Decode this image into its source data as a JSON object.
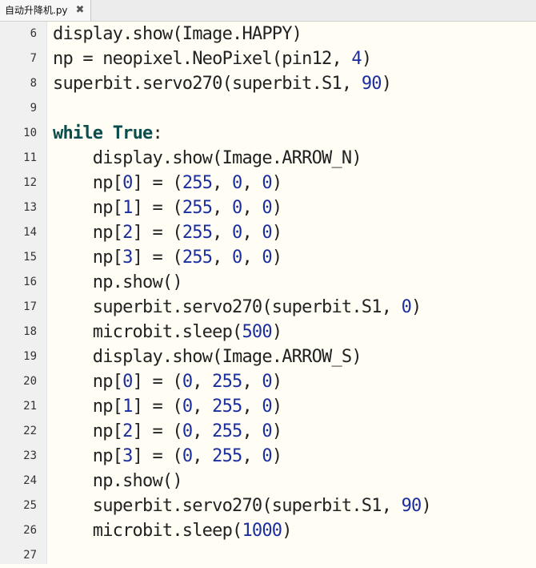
{
  "tab": {
    "title": "自动升降机.py",
    "close_icon": "✖"
  },
  "lines": [
    {
      "n": "6",
      "indent": "",
      "parts": [
        [
          "t",
          "display.show(Image.HAPPY)"
        ]
      ]
    },
    {
      "n": "7",
      "indent": "",
      "parts": [
        [
          "t",
          "np = neopixel.NeoPixel(pin12, "
        ],
        [
          "n",
          "4"
        ],
        [
          "t",
          ")"
        ]
      ]
    },
    {
      "n": "8",
      "indent": "",
      "parts": [
        [
          "t",
          "superbit.servo270(superbit.S1, "
        ],
        [
          "n",
          "90"
        ],
        [
          "t",
          ")"
        ]
      ]
    },
    {
      "n": "9",
      "indent": "",
      "parts": []
    },
    {
      "n": "10",
      "indent": "",
      "parts": [
        [
          "k",
          "while"
        ],
        [
          "t",
          " "
        ],
        [
          "k",
          "True"
        ],
        [
          "t",
          ":"
        ]
      ]
    },
    {
      "n": "11",
      "indent": "    ",
      "parts": [
        [
          "t",
          "display.show(Image.ARROW_N)"
        ]
      ]
    },
    {
      "n": "12",
      "indent": "    ",
      "parts": [
        [
          "t",
          "np["
        ],
        [
          "n",
          "0"
        ],
        [
          "t",
          "] = ("
        ],
        [
          "n",
          "255"
        ],
        [
          "t",
          ", "
        ],
        [
          "n",
          "0"
        ],
        [
          "t",
          ", "
        ],
        [
          "n",
          "0"
        ],
        [
          "t",
          ")"
        ]
      ]
    },
    {
      "n": "13",
      "indent": "    ",
      "parts": [
        [
          "t",
          "np["
        ],
        [
          "n",
          "1"
        ],
        [
          "t",
          "] = ("
        ],
        [
          "n",
          "255"
        ],
        [
          "t",
          ", "
        ],
        [
          "n",
          "0"
        ],
        [
          "t",
          ", "
        ],
        [
          "n",
          "0"
        ],
        [
          "t",
          ")"
        ]
      ]
    },
    {
      "n": "14",
      "indent": "    ",
      "parts": [
        [
          "t",
          "np["
        ],
        [
          "n",
          "2"
        ],
        [
          "t",
          "] = ("
        ],
        [
          "n",
          "255"
        ],
        [
          "t",
          ", "
        ],
        [
          "n",
          "0"
        ],
        [
          "t",
          ", "
        ],
        [
          "n",
          "0"
        ],
        [
          "t",
          ")"
        ]
      ]
    },
    {
      "n": "15",
      "indent": "    ",
      "parts": [
        [
          "t",
          "np["
        ],
        [
          "n",
          "3"
        ],
        [
          "t",
          "] = ("
        ],
        [
          "n",
          "255"
        ],
        [
          "t",
          ", "
        ],
        [
          "n",
          "0"
        ],
        [
          "t",
          ", "
        ],
        [
          "n",
          "0"
        ],
        [
          "t",
          ")"
        ]
      ]
    },
    {
      "n": "16",
      "indent": "    ",
      "parts": [
        [
          "t",
          "np.show()"
        ]
      ]
    },
    {
      "n": "17",
      "indent": "    ",
      "parts": [
        [
          "t",
          "superbit.servo270(superbit.S1, "
        ],
        [
          "n",
          "0"
        ],
        [
          "t",
          ")"
        ]
      ]
    },
    {
      "n": "18",
      "indent": "    ",
      "parts": [
        [
          "t",
          "microbit.sleep("
        ],
        [
          "n",
          "500"
        ],
        [
          "t",
          ")"
        ]
      ]
    },
    {
      "n": "19",
      "indent": "    ",
      "parts": [
        [
          "t",
          "display.show(Image.ARROW_S)"
        ]
      ]
    },
    {
      "n": "20",
      "indent": "    ",
      "parts": [
        [
          "t",
          "np["
        ],
        [
          "n",
          "0"
        ],
        [
          "t",
          "] = ("
        ],
        [
          "n",
          "0"
        ],
        [
          "t",
          ", "
        ],
        [
          "n",
          "255"
        ],
        [
          "t",
          ", "
        ],
        [
          "n",
          "0"
        ],
        [
          "t",
          ")"
        ]
      ]
    },
    {
      "n": "21",
      "indent": "    ",
      "parts": [
        [
          "t",
          "np["
        ],
        [
          "n",
          "1"
        ],
        [
          "t",
          "] = ("
        ],
        [
          "n",
          "0"
        ],
        [
          "t",
          ", "
        ],
        [
          "n",
          "255"
        ],
        [
          "t",
          ", "
        ],
        [
          "n",
          "0"
        ],
        [
          "t",
          ")"
        ]
      ]
    },
    {
      "n": "22",
      "indent": "    ",
      "parts": [
        [
          "t",
          "np["
        ],
        [
          "n",
          "2"
        ],
        [
          "t",
          "] = ("
        ],
        [
          "n",
          "0"
        ],
        [
          "t",
          ", "
        ],
        [
          "n",
          "255"
        ],
        [
          "t",
          ", "
        ],
        [
          "n",
          "0"
        ],
        [
          "t",
          ")"
        ]
      ]
    },
    {
      "n": "23",
      "indent": "    ",
      "parts": [
        [
          "t",
          "np["
        ],
        [
          "n",
          "3"
        ],
        [
          "t",
          "] = ("
        ],
        [
          "n",
          "0"
        ],
        [
          "t",
          ", "
        ],
        [
          "n",
          "255"
        ],
        [
          "t",
          ", "
        ],
        [
          "n",
          "0"
        ],
        [
          "t",
          ")"
        ]
      ]
    },
    {
      "n": "24",
      "indent": "    ",
      "parts": [
        [
          "t",
          "np.show()"
        ]
      ]
    },
    {
      "n": "25",
      "indent": "    ",
      "parts": [
        [
          "t",
          "superbit.servo270(superbit.S1, "
        ],
        [
          "n",
          "90"
        ],
        [
          "t",
          ")"
        ]
      ]
    },
    {
      "n": "26",
      "indent": "    ",
      "parts": [
        [
          "t",
          "microbit.sleep("
        ],
        [
          "n",
          "1000"
        ],
        [
          "t",
          ")"
        ]
      ]
    },
    {
      "n": "27",
      "indent": "",
      "parts": []
    }
  ],
  "colors": {
    "background": "#fffdf4",
    "keyword": "#0a4d4d",
    "number": "#1a2ea0",
    "text": "#222222"
  }
}
